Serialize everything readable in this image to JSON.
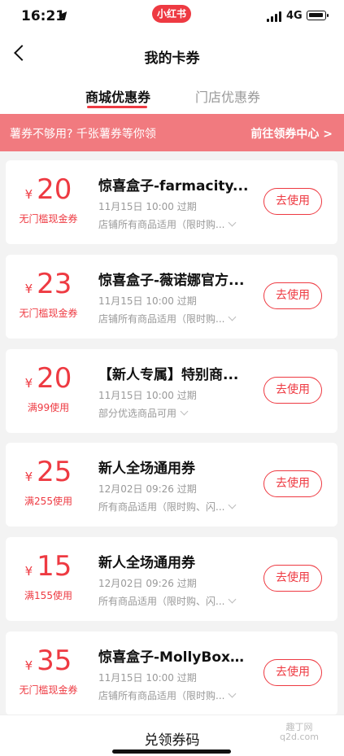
{
  "status_bar": {
    "time": "16:21",
    "app_badge": "小红书",
    "network": "4G"
  },
  "nav": {
    "title": "我的卡券"
  },
  "tabs": [
    {
      "label": "商城优惠券"
    },
    {
      "label": "门店优惠券"
    }
  ],
  "banner": {
    "text": "薯券不够用? 千张薯券等你领",
    "link": "前往领券中心 >"
  },
  "coupons": [
    {
      "currency": "¥",
      "amount": "20",
      "condition": "无门槛现金券",
      "name": "惊喜盒子-farmacity...",
      "expire": "11月15日 10:00 过期",
      "scope": "店铺所有商品适用（限时购...",
      "button": "去使用"
    },
    {
      "currency": "¥",
      "amount": "23",
      "condition": "无门槛现金券",
      "name": "惊喜盒子-薇诺娜官方...",
      "expire": "11月15日 10:00 过期",
      "scope": "店铺所有商品适用（限时购...",
      "button": "去使用"
    },
    {
      "currency": "¥",
      "amount": "20",
      "condition": "满99使用",
      "name": "【新人专属】特别商...",
      "expire": "11月15日 10:00 过期",
      "scope": "部分优选商品可用",
      "button": "去使用"
    },
    {
      "currency": "¥",
      "amount": "25",
      "condition": "满255使用",
      "name": "新人全场通用券",
      "expire": "12月02日 09:26 过期",
      "scope": "所有商品适用（限时购、闪...",
      "button": "去使用"
    },
    {
      "currency": "¥",
      "amount": "15",
      "condition": "满155使用",
      "name": "新人全场通用券",
      "expire": "12月02日 09:26 过期",
      "scope": "所有商品适用（限时购、闪...",
      "button": "去使用"
    },
    {
      "currency": "¥",
      "amount": "35",
      "condition": "无门槛现金券",
      "name": "惊喜盒子-MollyBox魔...",
      "expire": "11月15日 10:00 过期",
      "scope": "店铺所有商品适用（限时购...",
      "button": "去使用"
    }
  ],
  "bottom": {
    "label": "兑领券码"
  },
  "watermark": {
    "line1": "趣丁网",
    "line2": "q2d.com"
  },
  "colors": {
    "accent": "#ee3a42",
    "banner": "#f17a7f"
  }
}
